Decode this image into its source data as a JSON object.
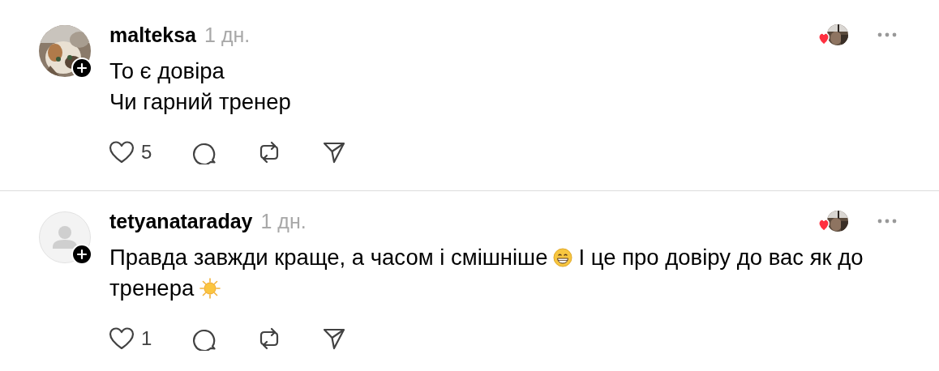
{
  "comments": [
    {
      "username": "malteksa",
      "time": "1 дн.",
      "avatar": {
        "kind": "picture"
      },
      "liked_by_author": true,
      "likes": "5",
      "paragraphs": [
        [
          {
            "kind": "text",
            "text": "То є довіра"
          }
        ],
        [
          {
            "kind": "text",
            "text": "Чи гарний тренер"
          }
        ]
      ]
    },
    {
      "username": "tetyanataraday",
      "time": "1 дн.",
      "avatar": {
        "kind": "default"
      },
      "liked_by_author": true,
      "likes": "1",
      "paragraphs": [
        [
          {
            "kind": "text",
            "text": "Правда завжди краще, а часом і смішніше"
          },
          {
            "kind": "grin-emoji"
          },
          {
            "kind": "text",
            "text": "І це про довіру до вас як до"
          },
          {
            "kind": "text",
            "text": "тренера"
          },
          {
            "kind": "sun-emoji"
          }
        ]
      ]
    }
  ]
}
